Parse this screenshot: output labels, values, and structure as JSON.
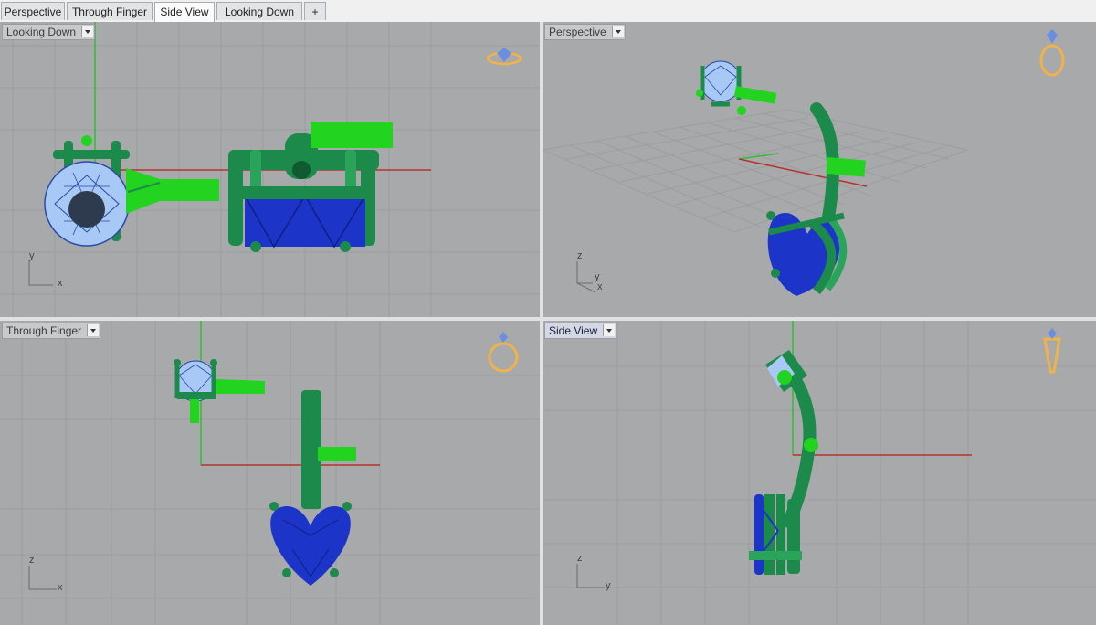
{
  "tabs": [
    {
      "label": "Perspective",
      "active": false
    },
    {
      "label": "Through Finger",
      "active": false
    },
    {
      "label": "Side View",
      "active": true
    },
    {
      "label": "Looking Down",
      "active": false
    },
    {
      "label": "+",
      "active": false
    }
  ],
  "viewports": {
    "top_left": {
      "label": "Looking Down",
      "axis_y": "y",
      "axis_x": "x"
    },
    "top_right": {
      "label": "Perspective",
      "axis_z": "z",
      "axis_y": "y",
      "axis_x": "x"
    },
    "bottom_left": {
      "label": "Through Finger",
      "axis_z": "z",
      "axis_x": "x"
    },
    "bottom_right": {
      "label": "Side View",
      "axis_z": "z",
      "axis_y": "y"
    }
  },
  "colors": {
    "viewport_bg": "#a8a9ab",
    "grid_line": "#9a9b9e",
    "grid_major": "#8d8f93",
    "axis_x": "#b4332c",
    "axis_y": "#2fbf2f",
    "metal_green": "#1c8a4a",
    "bright_green": "#22d320",
    "gem_light": "#a8c8f5",
    "gem_dark": "#1c35c8",
    "gizmo_gold": "#f0b24a",
    "gizmo_gem": "#6a8fe0"
  },
  "icons": {
    "dropdown": "chevron-down-icon",
    "gizmo": "ring-orientation-icon"
  }
}
